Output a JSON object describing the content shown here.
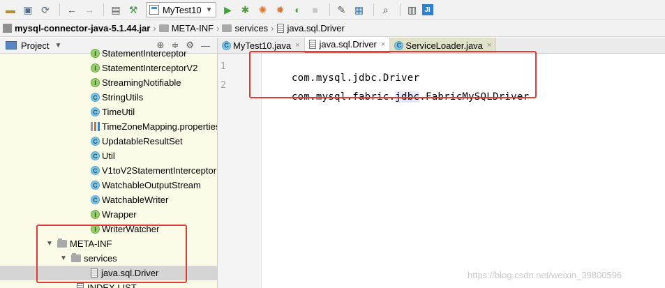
{
  "toolbar": {
    "run_config": "MyTest10",
    "icons": [
      "open-icon",
      "save-icon",
      "sync-icon",
      "back-icon",
      "forward-icon",
      "project-structure-icon",
      "build-icon",
      "run-icon",
      "debug-icon",
      "coverage-icon",
      "profile-icon",
      "run-with-icon",
      "stop-icon",
      "settings-icon",
      "sdk-icon",
      "search-icon",
      "terminal-icon",
      "jrebel-icon"
    ]
  },
  "breadcrumb": {
    "jar": "mysql-connector-java-5.1.44.jar",
    "folder1": "META-INF",
    "folder2": "services",
    "file": "java.sql.Driver"
  },
  "project_panel": {
    "title": "Project",
    "items": [
      {
        "label": "StatementInterceptor",
        "kind": "interface"
      },
      {
        "label": "StatementInterceptorV2",
        "kind": "interface"
      },
      {
        "label": "StreamingNotifiable",
        "kind": "interface"
      },
      {
        "label": "StringUtils",
        "kind": "class"
      },
      {
        "label": "TimeUtil",
        "kind": "class"
      },
      {
        "label": "TimeZoneMapping.properties",
        "kind": "properties"
      },
      {
        "label": "UpdatableResultSet",
        "kind": "class"
      },
      {
        "label": "Util",
        "kind": "class"
      },
      {
        "label": "V1toV2StatementInterceptor",
        "kind": "class"
      },
      {
        "label": "WatchableOutputStream",
        "kind": "class"
      },
      {
        "label": "WatchableWriter",
        "kind": "class"
      },
      {
        "label": "Wrapper",
        "kind": "interface"
      },
      {
        "label": "WriterWatcher",
        "kind": "interface"
      },
      {
        "label": "META-INF",
        "kind": "folder"
      },
      {
        "label": "services",
        "kind": "folder"
      },
      {
        "label": "java.sql.Driver",
        "kind": "file"
      },
      {
        "label": "INDEX.LIST",
        "kind": "file"
      }
    ]
  },
  "tabs": [
    {
      "label": "MyTest10.java",
      "close": "×"
    },
    {
      "label": "java.sql.Driver",
      "close": "×"
    },
    {
      "label": "ServiceLoader.java",
      "close": "×"
    }
  ],
  "editor": {
    "line_numbers": [
      "1",
      "2"
    ],
    "line1": "com.mysql.jdbc.Driver",
    "line2_pre": "com.mysql.fabric.",
    "line2_hl": "jdbc",
    "line2_post": ".FabricMySQLDriver"
  },
  "watermark": "https://blog.csdn.net/weixin_39800596",
  "colors": {
    "accent": "#4f8ed1",
    "annotation": "#e53935",
    "panel_bg": "#fbfbe8"
  }
}
